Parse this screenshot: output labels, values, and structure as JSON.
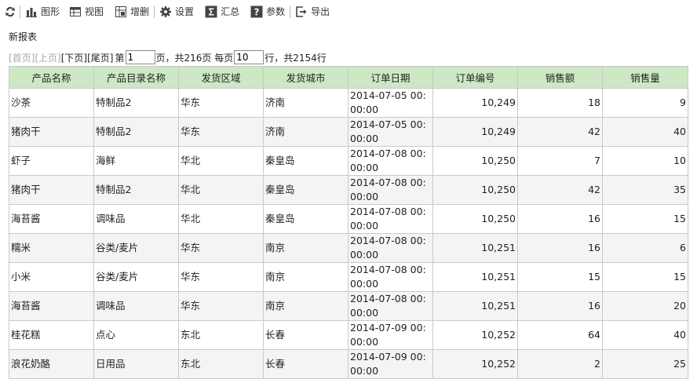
{
  "toolbar": {
    "refresh_icon": "refresh-icon",
    "chart_label": "图形",
    "view_label": "视图",
    "edit_label": "增删",
    "settings_label": "设置",
    "summary_label": "汇总",
    "params_label": "参数",
    "export_label": "导出"
  },
  "report": {
    "title": "新报表"
  },
  "pager": {
    "first": "[首页]",
    "prev": "[上页]",
    "next": "[下页]",
    "last": "[尾页]",
    "page_prefix": "第",
    "page_value": "1",
    "page_suffix": "页，共216页 每页",
    "per_page_value": "10",
    "rows_suffix": "行，共2154行"
  },
  "table": {
    "columns": [
      "产品名称",
      "产品目录名称",
      "发货区域",
      "发货城市",
      "订单日期",
      "订单编号",
      "销售额",
      "销售量"
    ],
    "rows": [
      [
        "沙茶",
        "特制品2",
        "华东",
        "济南",
        "2014-07-05 00:00:00",
        "10,249",
        "18",
        "9"
      ],
      [
        "猪肉干",
        "特制品2",
        "华东",
        "济南",
        "2014-07-05 00:00:00",
        "10,249",
        "42",
        "40"
      ],
      [
        "虾子",
        "海鲜",
        "华北",
        "秦皇岛",
        "2014-07-08 00:00:00",
        "10,250",
        "7",
        "10"
      ],
      [
        "猪肉干",
        "特制品2",
        "华北",
        "秦皇岛",
        "2014-07-08 00:00:00",
        "10,250",
        "42",
        "35"
      ],
      [
        "海苔酱",
        "调味品",
        "华北",
        "秦皇岛",
        "2014-07-08 00:00:00",
        "10,250",
        "16",
        "15"
      ],
      [
        "糯米",
        "谷类/麦片",
        "华东",
        "南京",
        "2014-07-08 00:00:00",
        "10,251",
        "16",
        "6"
      ],
      [
        "小米",
        "谷类/麦片",
        "华东",
        "南京",
        "2014-07-08 00:00:00",
        "10,251",
        "15",
        "15"
      ],
      [
        "海苔酱",
        "调味品",
        "华东",
        "南京",
        "2014-07-08 00:00:00",
        "10,251",
        "16",
        "20"
      ],
      [
        "桂花糕",
        "点心",
        "东北",
        "长春",
        "2014-07-09 00:00:00",
        "10,252",
        "64",
        "40"
      ],
      [
        "浪花奶酪",
        "日用品",
        "东北",
        "长春",
        "2014-07-09 00:00:00",
        "10,252",
        "2",
        "25"
      ]
    ]
  }
}
